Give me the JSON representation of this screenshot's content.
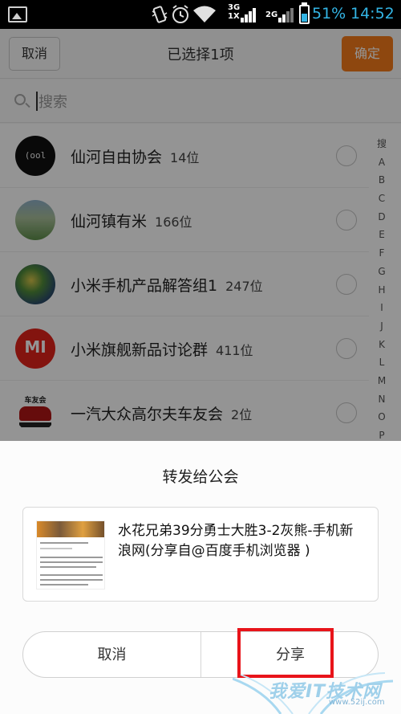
{
  "status_bar": {
    "net1": "3G",
    "net1b": "1X",
    "net2": "2G",
    "battery": "51%",
    "time": "14:52",
    "battery_level": 0.51,
    "icons": [
      "gallery-icon",
      "vibrate-icon",
      "alarm-icon",
      "wifi-icon",
      "signal-icon",
      "battery-icon"
    ]
  },
  "header": {
    "cancel_label": "取消",
    "title": "已选择1项",
    "confirm_label": "确定",
    "accent_color": "#f57a1a"
  },
  "search": {
    "placeholder": "搜索"
  },
  "groups": [
    {
      "name": "仙河自由协会",
      "count": "14位",
      "avatar": "cool"
    },
    {
      "name": "仙河镇有米",
      "count": "166位",
      "avatar": "landscape"
    },
    {
      "name": "小米手机产品解答组1",
      "count": "247位",
      "avatar": "painting"
    },
    {
      "name": "小米旗舰新品讨论群",
      "count": "411位",
      "avatar": "mi-logo"
    },
    {
      "name": "一汽大众高尔夫车友会",
      "count": "2位",
      "avatar": "car"
    }
  ],
  "avatar_text": {
    "cool": "(ool",
    "mi": "MI",
    "car": "车友会"
  },
  "index": [
    "搜",
    "A",
    "B",
    "C",
    "D",
    "E",
    "F",
    "G",
    "H",
    "I",
    "J",
    "K",
    "L",
    "M",
    "N",
    "O",
    "P"
  ],
  "share_sheet": {
    "title": "转发给公会",
    "card_text": "水花兄弟39分勇士大胜3-2灰熊-手机新浪网(分享自@百度手机浏览器 )",
    "cancel_label": "取消",
    "share_label": "分享",
    "highlight_color": "#e8141a"
  },
  "watermark": {
    "text": "我爱IT技术网",
    "url": "www.52ij.com"
  }
}
